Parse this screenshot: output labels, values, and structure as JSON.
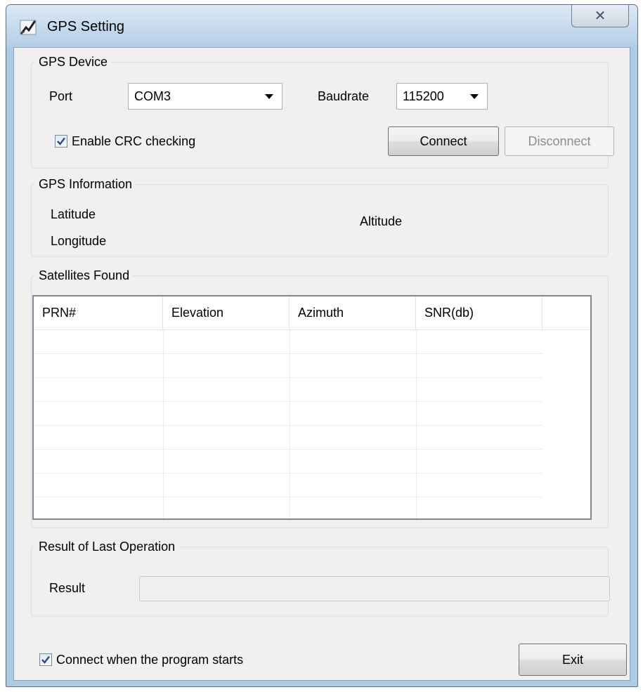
{
  "window": {
    "title": "GPS Setting",
    "close_glyph": "✕"
  },
  "gps_device": {
    "group_label": "GPS Device",
    "port_label": "Port",
    "port_value": "COM3",
    "baudrate_label": "Baudrate",
    "baudrate_value": "115200",
    "crc_label": "Enable CRC checking",
    "crc_checked": true,
    "connect_label": "Connect",
    "disconnect_label": "Disconnect"
  },
  "gps_info": {
    "group_label": "GPS Information",
    "latitude_label": "Latitude",
    "longitude_label": "Longitude",
    "altitude_label": "Altitude"
  },
  "satellites": {
    "group_label": "Satellites Found",
    "columns": [
      "PRN#",
      "Elevation",
      "Azimuth",
      "SNR(db)"
    ],
    "rows": []
  },
  "result": {
    "group_label": "Result of Last Operation",
    "result_label": "Result",
    "result_value": ""
  },
  "footer": {
    "autoconnect_label": "Connect when the program starts",
    "autoconnect_checked": true,
    "exit_label": "Exit"
  },
  "icons": [
    "app-icon",
    "close-icon",
    "dropdown-arrow-icon",
    "checkmark-icon"
  ]
}
